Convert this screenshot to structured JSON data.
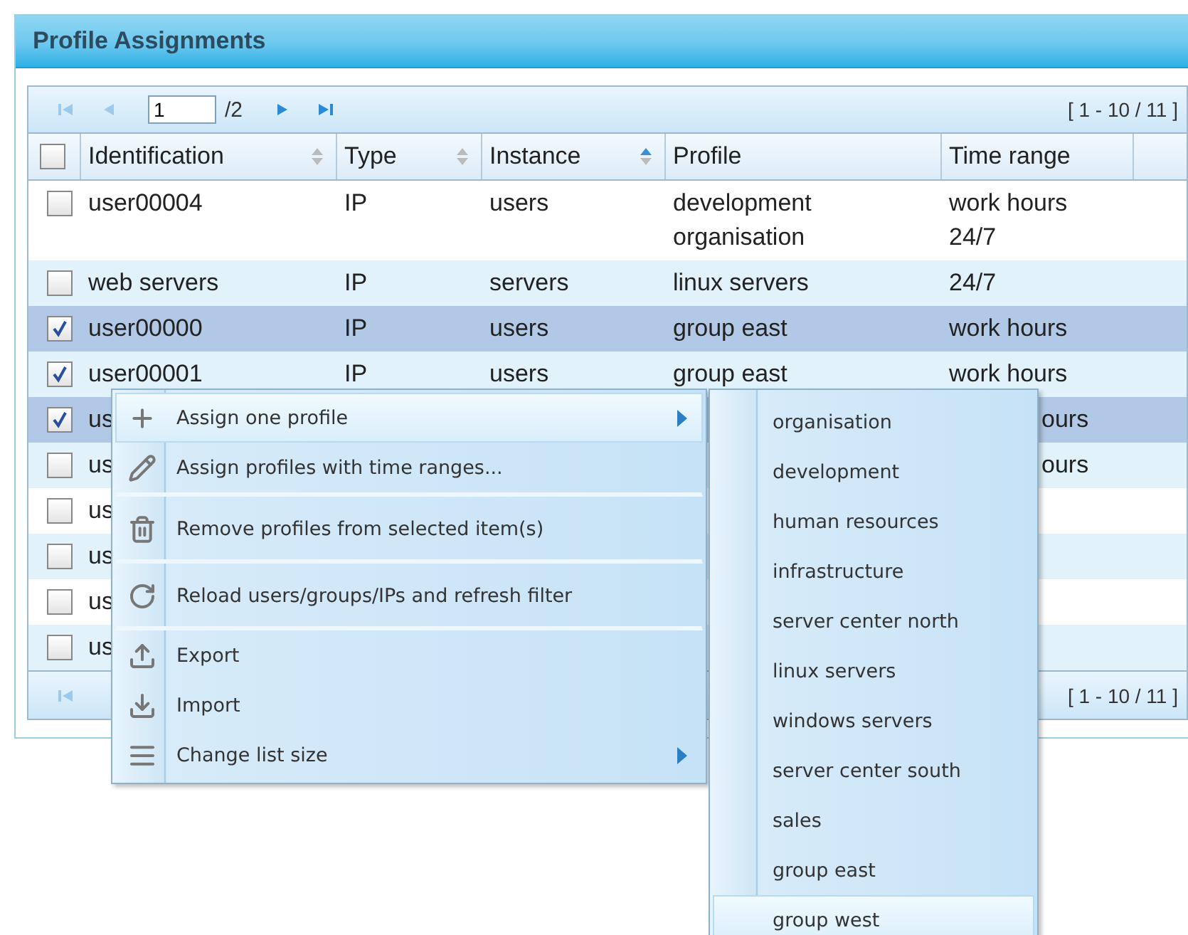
{
  "panel": {
    "title": "Profile Assignments"
  },
  "pager": {
    "page": "1",
    "total": "/2",
    "range": "[ 1 - 10 / 11 ]",
    "first_disabled": true,
    "prev_disabled": true
  },
  "columns": [
    {
      "label": "Identification",
      "sortable": true,
      "sorted": false
    },
    {
      "label": "Type",
      "sortable": true,
      "sorted": false
    },
    {
      "label": "Instance",
      "sortable": true,
      "sorted": true
    },
    {
      "label": "Profile",
      "sortable": false
    },
    {
      "label": "Time range",
      "sortable": false
    }
  ],
  "header_checked": false,
  "rows": [
    {
      "checked": false,
      "selected": false,
      "covered": false,
      "cells": [
        [
          "user00004"
        ],
        [
          "IP"
        ],
        [
          "users"
        ],
        [
          "development",
          "organisation"
        ],
        [
          "work hours",
          "24/7"
        ]
      ]
    },
    {
      "checked": false,
      "selected": false,
      "covered": false,
      "cells": [
        [
          "web servers"
        ],
        [
          "IP"
        ],
        [
          "servers"
        ],
        [
          "linux servers"
        ],
        [
          "24/7"
        ]
      ]
    },
    {
      "checked": true,
      "selected": true,
      "covered": false,
      "cells": [
        [
          "user00000"
        ],
        [
          "IP"
        ],
        [
          "users"
        ],
        [
          "group east"
        ],
        [
          "work hours"
        ]
      ]
    },
    {
      "checked": true,
      "selected": false,
      "covered": false,
      "cells": [
        [
          "user00001"
        ],
        [
          "IP"
        ],
        [
          "users"
        ],
        [
          "group east"
        ],
        [
          "work hours"
        ]
      ]
    },
    {
      "checked": true,
      "selected": true,
      "covered": true,
      "cells": [
        [
          "us"
        ],
        [],
        [],
        [],
        [
          "ours"
        ]
      ]
    },
    {
      "checked": false,
      "selected": false,
      "covered": true,
      "cells": [
        [
          "us"
        ],
        [],
        [],
        [],
        [
          "ours"
        ]
      ]
    },
    {
      "checked": false,
      "selected": false,
      "cells": [
        [
          "us"
        ],
        [],
        [],
        [],
        []
      ]
    },
    {
      "checked": false,
      "selected": false,
      "cells": [
        [
          "us"
        ],
        [],
        [],
        [],
        []
      ]
    },
    {
      "checked": false,
      "selected": false,
      "cells": [
        [
          "us"
        ],
        [],
        [],
        [],
        []
      ]
    },
    {
      "checked": false,
      "selected": false,
      "cells": [
        [
          "us"
        ],
        [],
        [],
        [],
        []
      ]
    }
  ],
  "footer": {
    "range": "[ 1 - 10 / 11 ]"
  },
  "context_menu": {
    "items": [
      {
        "label": "Assign one profile",
        "submenu": true,
        "highlighted": true,
        "separator_after": false
      },
      {
        "label": "Assign profiles with time ranges...",
        "submenu": false,
        "highlighted": false,
        "separator_after": true
      },
      {
        "label": "Remove profiles from selected item(s)",
        "submenu": false,
        "highlighted": false,
        "separator_after": true
      },
      {
        "label": "Reload users/groups/IPs and refresh filter",
        "submenu": false,
        "highlighted": false,
        "separator_after": true
      },
      {
        "label": "Export",
        "submenu": false,
        "highlighted": false,
        "separator_after": false
      },
      {
        "label": "Import",
        "submenu": false,
        "highlighted": false,
        "separator_after": false
      },
      {
        "label": "Change list size",
        "submenu": true,
        "highlighted": false,
        "separator_after": false
      }
    ]
  },
  "submenu": {
    "items": [
      {
        "label": "organisation",
        "highlighted": false
      },
      {
        "label": "development",
        "highlighted": false
      },
      {
        "label": "human resources",
        "highlighted": false
      },
      {
        "label": "infrastructure",
        "highlighted": false
      },
      {
        "label": "server center north",
        "highlighted": false
      },
      {
        "label": "linux servers",
        "highlighted": false
      },
      {
        "label": "windows servers",
        "highlighted": false
      },
      {
        "label": "server center south",
        "highlighted": false
      },
      {
        "label": "sales",
        "highlighted": false
      },
      {
        "label": "group east",
        "highlighted": false
      },
      {
        "label": "group west",
        "highlighted": true
      }
    ]
  }
}
